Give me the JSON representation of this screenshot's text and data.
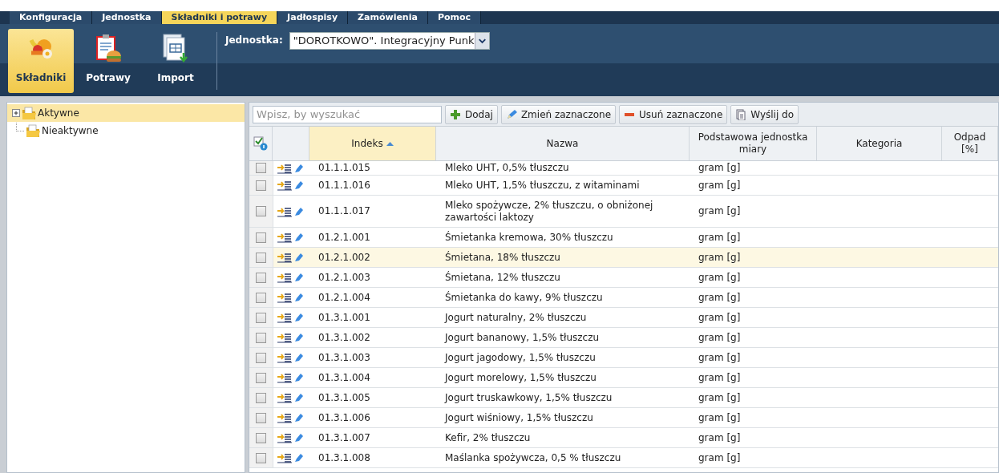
{
  "menu": [
    {
      "label": "Konfiguracja",
      "selected": false
    },
    {
      "label": "Jednostka",
      "selected": false
    },
    {
      "label": "Składniki i potrawy",
      "selected": true
    },
    {
      "label": "Jadłospisy",
      "selected": false
    },
    {
      "label": "Zamówienia",
      "selected": false
    },
    {
      "label": "Pomoc",
      "selected": false
    }
  ],
  "ribbon": [
    {
      "label": "Składniki",
      "kind": "food",
      "selected": true
    },
    {
      "label": "Potrawy",
      "kind": "dish",
      "selected": false
    },
    {
      "label": "Import",
      "kind": "import",
      "selected": false
    }
  ],
  "unit_select": {
    "label": "Jednostka:",
    "value": "\"DOROTKOWO\". Integracyjny Punk"
  },
  "tree": [
    {
      "label": "Aktywne",
      "selected": true,
      "expanded": false
    },
    {
      "label": "Nieaktywne",
      "selected": false
    }
  ],
  "toolbar": {
    "search": {
      "placeholder": "Wpisz, by wyszukać"
    },
    "buttons": [
      {
        "label": "Dodaj",
        "kind": "add"
      },
      {
        "label": "Zmień zaznaczone",
        "kind": "edit"
      },
      {
        "label": "Usuń zaznaczone",
        "kind": "remove"
      },
      {
        "label": "Wyślij do",
        "kind": "send"
      }
    ]
  },
  "table": {
    "columns": [
      {
        "label": "Indeks",
        "sorted": true
      },
      {
        "label": "Nazwa",
        "sorted": false
      },
      {
        "label": "Podstawowa jednostka miary",
        "sorted": false
      },
      {
        "label": "Kategoria",
        "sorted": false
      },
      {
        "label": "Odpad [%]",
        "sorted": false
      }
    ],
    "rows": [
      {
        "index": "01.1.1.015",
        "name": "Mleko UHT, 0,5% tłuszczu",
        "unit": "gram [g]",
        "checked": false,
        "hovered": false
      },
      {
        "index": "01.1.1.016",
        "name": "Mleko UHT, 1,5% tłuszczu, z witaminami",
        "unit": "gram [g]",
        "checked": false,
        "hovered": false
      },
      {
        "index": "01.1.1.017",
        "name": "Mleko spożywcze, 2% tłuszczu, o obniżonej zawartości laktozy",
        "unit": "gram [g]",
        "checked": false,
        "hovered": false
      },
      {
        "index": "01.2.1.001",
        "name": "Śmietanka kremowa, 30% tłuszczu",
        "unit": "gram [g]",
        "checked": false,
        "hovered": false
      },
      {
        "index": "01.2.1.002",
        "name": "Śmietana, 18% tłuszczu",
        "unit": "gram [g]",
        "checked": false,
        "hovered": true
      },
      {
        "index": "01.2.1.003",
        "name": "Śmietana, 12% tłuszczu",
        "unit": "gram [g]",
        "checked": false,
        "hovered": false
      },
      {
        "index": "01.2.1.004",
        "name": "Śmietanka do kawy, 9% tłuszczu",
        "unit": "gram [g]",
        "checked": false,
        "hovered": false
      },
      {
        "index": "01.3.1.001",
        "name": "Jogurt naturalny, 2% tłuszczu",
        "unit": "gram [g]",
        "checked": false,
        "hovered": false
      },
      {
        "index": "01.3.1.002",
        "name": "Jogurt bananowy, 1,5% tłuszczu",
        "unit": "gram [g]",
        "checked": false,
        "hovered": false
      },
      {
        "index": "01.3.1.003",
        "name": "Jogurt jagodowy, 1,5% tłuszczu",
        "unit": "gram [g]",
        "checked": false,
        "hovered": false
      },
      {
        "index": "01.3.1.004",
        "name": "Jogurt morelowy, 1,5% tłuszczu",
        "unit": "gram [g]",
        "checked": false,
        "hovered": false
      },
      {
        "index": "01.3.1.005",
        "name": "Jogurt truskawkowy, 1,5% tłuszczu",
        "unit": "gram [g]",
        "checked": false,
        "hovered": false
      },
      {
        "index": "01.3.1.006",
        "name": "Jogurt wiśniowy, 1,5% tłuszczu",
        "unit": "gram [g]",
        "checked": false,
        "hovered": false
      },
      {
        "index": "01.3.1.007",
        "name": "Kefir, 2% tłuszczu",
        "unit": "gram [g]",
        "checked": false,
        "hovered": false
      },
      {
        "index": "01.3.1.008",
        "name": "Maślanka spożywcza, 0,5 % tłuszczu",
        "unit": "gram [g]",
        "checked": false,
        "hovered": false
      }
    ]
  }
}
